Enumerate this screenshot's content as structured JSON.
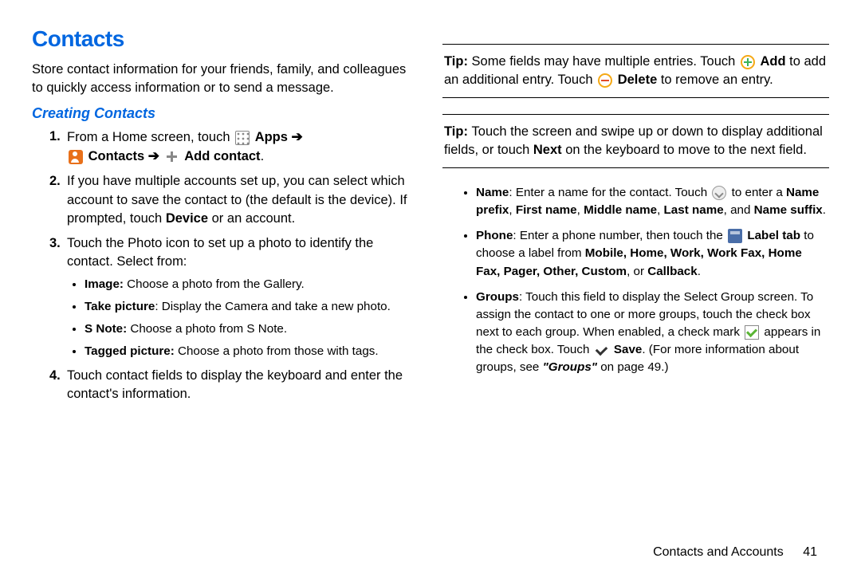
{
  "left": {
    "h1": "Contacts",
    "intro": "Store contact information for your friends, family, and colleagues to quickly access information or to send a message.",
    "h2": "Creating Contacts",
    "step1_a": "From a Home screen, touch",
    "apps_label": "Apps",
    "contacts_label": "Contacts",
    "addcontact_label": "Add contact",
    "step2_a": "If you have multiple accounts set up, you can select which account to save the contact to (the default is the device). If prompted, touch ",
    "step2_b": "Device",
    "step2_c": " or an account.",
    "step3": "Touch the Photo icon to set up a photo to identify the contact. Select from:",
    "step3_items": [
      {
        "b": "Image:",
        "t": " Choose a photo from the Gallery."
      },
      {
        "b": "Take picture",
        "t": ": Display the Camera and take a new photo."
      },
      {
        "b": "S Note:",
        "t": " Choose a photo from S Note."
      },
      {
        "b": "Tagged picture:",
        "t": " Choose a photo from those with tags."
      }
    ],
    "step4": "Touch contact fields to display the keyboard and enter the contact's information."
  },
  "right": {
    "tip1_a": "Tip: ",
    "tip1_b": "Some fields may have multiple entries. Touch",
    "tip1_add": "Add",
    "tip1_c": " to add an additional entry. Touch",
    "tip1_del": "Delete",
    "tip1_d": " to remove an entry.",
    "tip2_a": "Tip: ",
    "tip2_b": "Touch the screen and swipe up or down to display additional fields, or touch ",
    "tip2_next": "Next",
    "tip2_c": " on the keyboard to move to the next field.",
    "name_a": "Name",
    "name_b": ": Enter a name for the contact. Touch",
    "name_c": " to enter a ",
    "name_d": "Name prefix",
    "name_e": "First name",
    "name_f": "Middle name",
    "name_g": "Last name",
    "name_h": ", and ",
    "name_i": "Name suffix",
    "phone_a": "Phone",
    "phone_b": ": Enter a phone number, then touch the",
    "phone_label": "Label tab",
    "phone_c": " to choose a label from ",
    "phone_opts": "Mobile, Home, Work, Work Fax, Home Fax, Pager, Other, Custom",
    "phone_or": ", or ",
    "phone_last": "Callback",
    "groups_a": "Groups",
    "groups_b": ": Touch this field to display the Select Group screen. To assign the contact to one or more groups, touch the check box next to each group. When enabled, a check mark",
    "groups_c": " appears in the check box. Touch",
    "groups_save": "Save",
    "groups_d": ". (For more information about groups, see ",
    "groups_ref": "\"Groups\"",
    "groups_e": " on page 49.)"
  },
  "footer": {
    "section": "Contacts and Accounts",
    "page": "41"
  }
}
